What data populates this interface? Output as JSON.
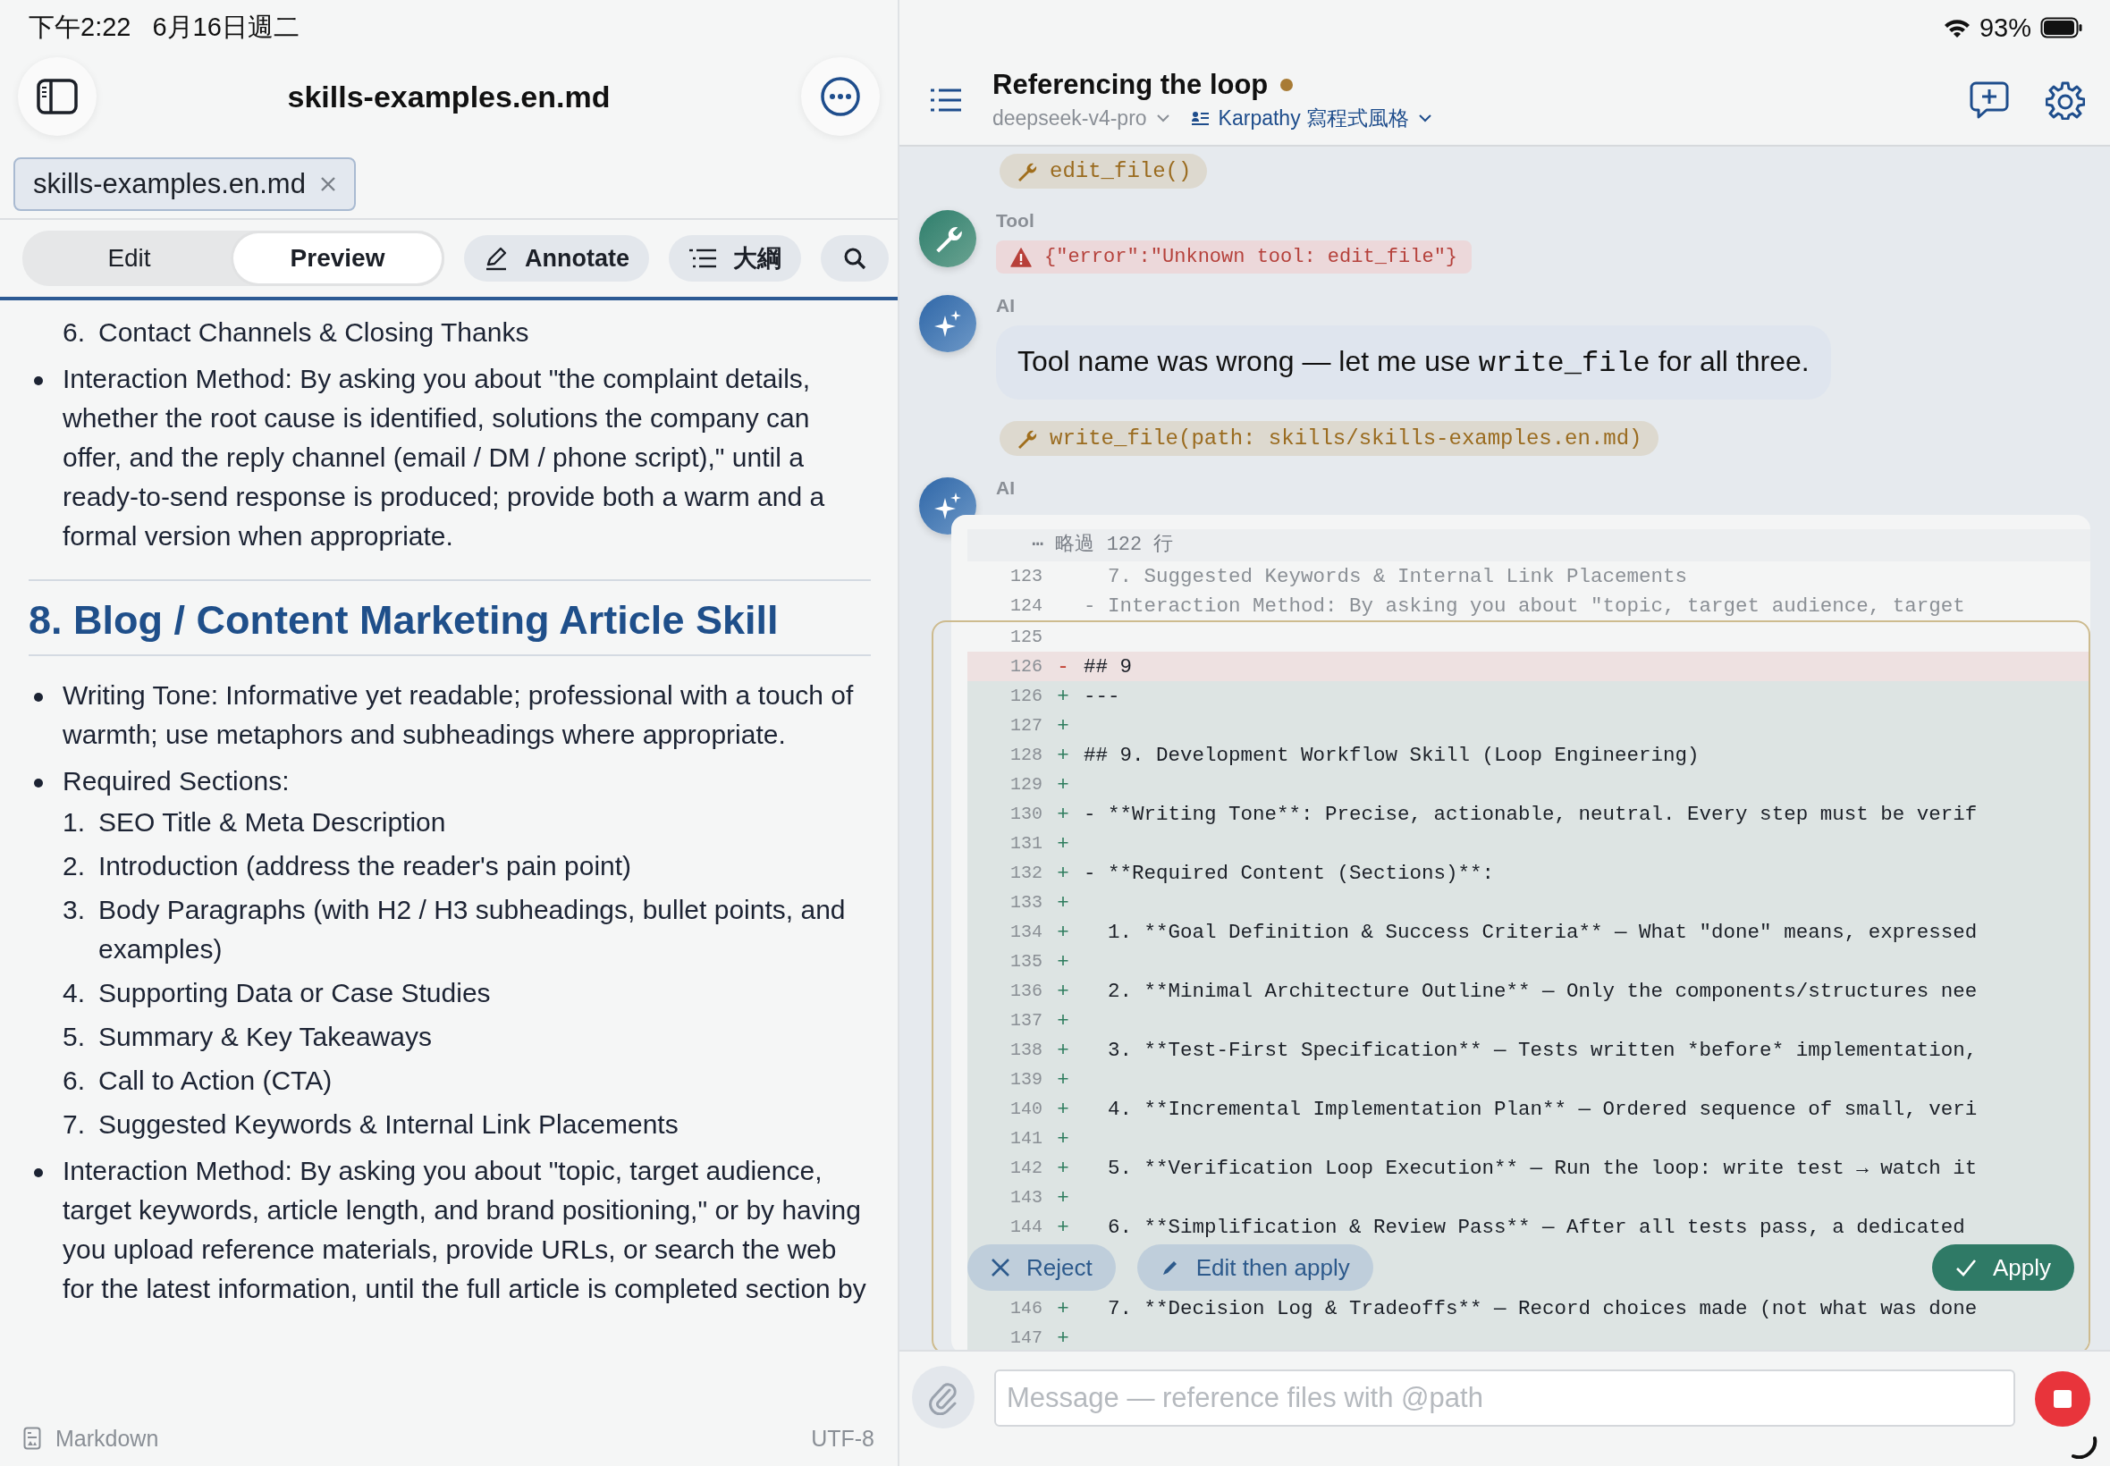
{
  "status_bar": {
    "time": "下午2:22",
    "date": "6月16日週二",
    "battery_text": "93%"
  },
  "editor": {
    "title": "skills-examples.en.md",
    "tabs": [
      {
        "label": "skills-examples.en.md",
        "selected": true
      }
    ],
    "modes": [
      {
        "label": "Edit",
        "selected": false
      },
      {
        "label": "Preview",
        "selected": true
      }
    ],
    "tools": [
      {
        "kind": "annotate",
        "label": "Annotate"
      },
      {
        "kind": "outline",
        "label": "大綱"
      },
      {
        "kind": "search"
      }
    ],
    "blocks": [
      {
        "kind": "ordered",
        "items": [
          {
            "marker": "6.",
            "text": "Contact Channels & Closing Thanks"
          }
        ]
      },
      {
        "kind": "bullet",
        "text": "Interaction Method: By asking you about \"the complaint details, whether the root cause is identified, solutions the company can offer, and the reply channel (email / DM / phone script),\" until a ready-to-send response is produced; provide both a warm and a formal version when appropriate."
      },
      {
        "kind": "rule"
      },
      {
        "kind": "heading",
        "text": "8. Blog / Content Marketing Article Skill"
      },
      {
        "kind": "bullet",
        "text": "Writing Tone: Informative yet readable; professional with a touch of warmth; use metaphors and subheadings where appropriate."
      },
      {
        "kind": "bullet",
        "text": "Required Sections:",
        "items": [
          {
            "marker": "1.",
            "text": "SEO Title & Meta Description"
          },
          {
            "marker": "2.",
            "text": "Introduction (address the reader's pain point)"
          },
          {
            "marker": "3.",
            "text": "Body Paragraphs (with H2 / H3 subheadings, bullet points, and examples)"
          },
          {
            "marker": "4.",
            "text": "Supporting Data or Case Studies"
          },
          {
            "marker": "5.",
            "text": "Summary & Key Takeaways"
          },
          {
            "marker": "6.",
            "text": "Call to Action (CTA)"
          },
          {
            "marker": "7.",
            "text": "Suggested Keywords & Internal Link Placements"
          }
        ]
      },
      {
        "kind": "bullet",
        "text": "Interaction Method: By asking you about \"topic, target audience, target keywords, article length, and brand positioning,\" or by having you upload reference materials, provide URLs, or search the web for the latest information, until the full article is completed section by"
      }
    ],
    "footer": {
      "format": "Markdown",
      "encoding": "UTF-8"
    }
  },
  "chat": {
    "title": "Referencing the loop",
    "busy": true,
    "model": "deepseek-v4-pro",
    "persona": "Karpathy 寫程式風格",
    "messages": [
      {
        "kind": "call",
        "text": "edit_file()"
      },
      {
        "kind": "tool-result",
        "author": "Tool",
        "text": "{\"error\":\"Unknown tool: edit_file\"}"
      },
      {
        "kind": "ai-text",
        "author": "AI",
        "parts": [
          {
            "text": "Tool name was wrong — let me use ",
            "code": false
          },
          {
            "text": "write_file",
            "code": true
          },
          {
            "text": " for all three.",
            "code": false
          }
        ]
      },
      {
        "kind": "call",
        "text": "write_file(path: skills/skills-examples.en.md)"
      },
      {
        "kind": "ai-diff",
        "author": "AI",
        "skipped": "⋯ 略過 122 行",
        "rows_before": [
          {
            "no": "123",
            "kind": "context",
            "text": "  7. Suggested Keywords & Internal Link Placements"
          },
          {
            "no": "124",
            "kind": "context",
            "text": "- Interaction Method: By asking you about \"topic, target audience, target"
          }
        ],
        "hunk_rows": [
          {
            "no": "125",
            "kind": "context"
          },
          {
            "no": "126",
            "kind": "removed",
            "sign": "-",
            "text": "## 9"
          },
          {
            "no": "126",
            "kind": "added",
            "sign": "+",
            "text": "---"
          },
          {
            "no": "127",
            "kind": "added",
            "sign": "+"
          },
          {
            "no": "128",
            "kind": "added",
            "sign": "+",
            "text": "## 9. Development Workflow Skill (Loop Engineering)"
          },
          {
            "no": "129",
            "kind": "added",
            "sign": "+"
          },
          {
            "no": "130",
            "kind": "added",
            "sign": "+",
            "text": "- **Writing Tone**: Precise, actionable, neutral. Every step must be verif"
          },
          {
            "no": "131",
            "kind": "added",
            "sign": "+"
          },
          {
            "no": "132",
            "kind": "added",
            "sign": "+",
            "text": "- **Required Content (Sections)**:"
          },
          {
            "no": "133",
            "kind": "added",
            "sign": "+"
          },
          {
            "no": "134",
            "kind": "added",
            "sign": "+",
            "text": "  1. **Goal Definition & Success Criteria** — What \"done\" means, expressed"
          },
          {
            "no": "135",
            "kind": "added",
            "sign": "+"
          },
          {
            "no": "136",
            "kind": "added",
            "sign": "+",
            "text": "  2. **Minimal Architecture Outline** — Only the components/structures nee"
          },
          {
            "no": "137",
            "kind": "added",
            "sign": "+"
          },
          {
            "no": "138",
            "kind": "added",
            "sign": "+",
            "text": "  3. **Test-First Specification** — Tests written *before* implementation,"
          },
          {
            "no": "139",
            "kind": "added",
            "sign": "+"
          },
          {
            "no": "140",
            "kind": "added",
            "sign": "+",
            "text": "  4. **Incremental Implementation Plan** — Ordered sequence of small, veri"
          },
          {
            "no": "141",
            "kind": "added",
            "sign": "+"
          },
          {
            "no": "142",
            "kind": "added",
            "sign": "+",
            "text": "  5. **Verification Loop Execution** — Run the loop: write test → watch it"
          },
          {
            "no": "143",
            "kind": "added",
            "sign": "+"
          },
          {
            "no": "144",
            "kind": "added",
            "sign": "+",
            "text": "  6. **Simplification & Review Pass** — After all tests pass, a dedicated"
          }
        ],
        "actions": [
          {
            "kind": "reject",
            "label": "Reject"
          },
          {
            "kind": "edit",
            "label": "Edit then apply"
          },
          {
            "kind": "apply",
            "label": "Apply"
          }
        ],
        "rows_after": [
          {
            "no": "146",
            "kind": "added",
            "sign": "+",
            "text": "  7. **Decision Log & Tradeoffs** — Record choices made (not what was done"
          },
          {
            "no": "147",
            "kind": "added",
            "sign": "+"
          }
        ]
      }
    ],
    "input": {
      "placeholder": "Message — reference files with @path"
    }
  }
}
